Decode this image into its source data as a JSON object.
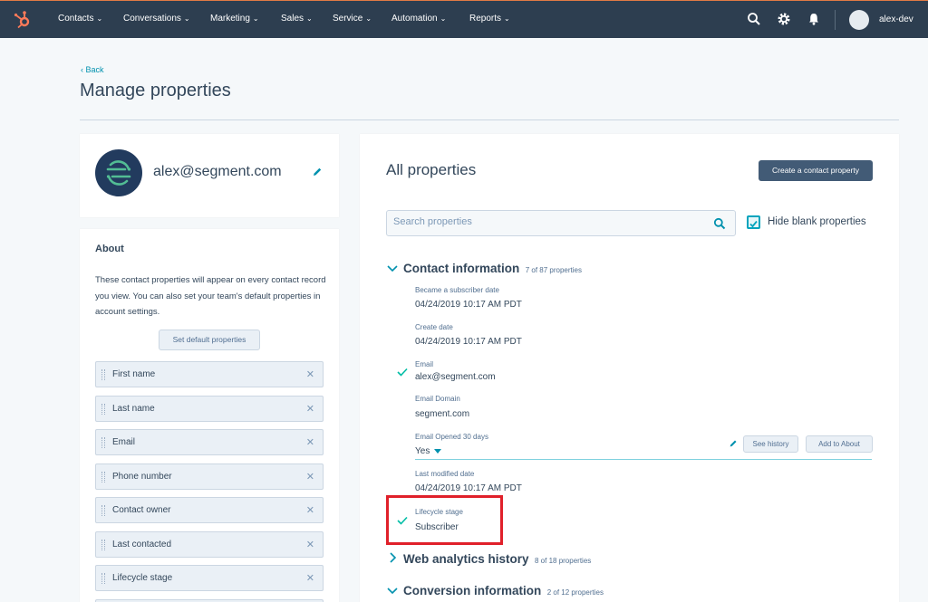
{
  "topnav": {
    "items": [
      {
        "label": "Contacts"
      },
      {
        "label": "Conversations"
      },
      {
        "label": "Marketing"
      },
      {
        "label": "Sales"
      },
      {
        "label": "Service"
      },
      {
        "label": "Automation"
      },
      {
        "label": "Reports"
      }
    ],
    "account_name": "alex-dev",
    "colors": {
      "bar": "#2d3e50",
      "logo": "#ff7a59"
    }
  },
  "header": {
    "back_label": "Back",
    "title": "Manage properties"
  },
  "contact": {
    "email": "alex@segment.com"
  },
  "about": {
    "title": "About",
    "description": "These contact properties will appear on every contact record you view. You can also set your team's default properties in account settings.",
    "set_default_label": "Set default properties",
    "properties": [
      "First name",
      "Last name",
      "Email",
      "Phone number",
      "Contact owner",
      "Last contacted",
      "Lifecycle stage"
    ]
  },
  "main": {
    "title": "All properties",
    "create_label": "Create a contact property",
    "search_placeholder": "Search properties",
    "hide_blank_label": "Hide blank properties",
    "hide_blank_checked": true,
    "sections": {
      "contact_info": {
        "name": "Contact information",
        "count": "7 of 87 properties",
        "expanded": true
      },
      "web_analytics": {
        "name": "Web analytics history",
        "count": "8 of 18 properties",
        "expanded": false
      },
      "conversion": {
        "name": "Conversion information",
        "count": "2 of 12 properties",
        "expanded": true
      }
    },
    "fields": {
      "subscriber_date": {
        "label": "Became a subscriber date",
        "value": "04/24/2019 10:17 AM PDT"
      },
      "create_date": {
        "label": "Create date",
        "value": "04/24/2019 10:17 AM PDT"
      },
      "email": {
        "label": "Email",
        "value": "alex@segment.com"
      },
      "email_domain": {
        "label": "Email Domain",
        "value": "segment.com"
      },
      "email_opened": {
        "label": "Email Opened 30 days",
        "value": "Yes"
      },
      "last_modified": {
        "label": "Last modified date",
        "value": "04/24/2019 10:17 AM PDT"
      },
      "lifecycle": {
        "label": "Lifecycle stage",
        "value": "Subscriber"
      }
    },
    "see_history_label": "See history",
    "add_to_about_label": "Add to About",
    "colors": {
      "accent": "#0091ae",
      "check": "#00bda5",
      "highlight": "#e0202a"
    }
  }
}
